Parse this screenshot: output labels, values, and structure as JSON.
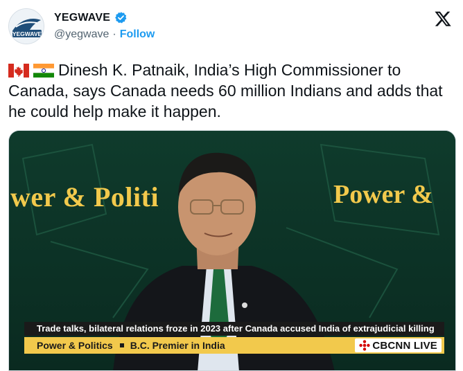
{
  "header": {
    "display_name": "YEGWAVE",
    "handle": "@yegwave",
    "separator": "·",
    "follow_label": "Follow",
    "avatar_text": "YEGWAVE"
  },
  "tweet": {
    "text": "Dinesh K. Patnaik, India’s High Commissioner to Canada, says Canada needs 60 million Indians and adds that he could help make it happen."
  },
  "video": {
    "show_left": "wer & Politi",
    "show_right": "Power &",
    "ticker": "Trade talks, bilateral relations froze in 2023 after Canada accused India of extrajudicial killing",
    "lower_a": "Power & Politics",
    "lower_b": "B.C. Premier in India",
    "live_badge": "CBCNN LIVE"
  },
  "colors": {
    "accent": "#1d9bf0",
    "verified": "#1d9bf0",
    "banner_yellow": "#f2c94c"
  },
  "icons": [
    "x-logo-icon",
    "verified-badge-icon",
    "canada-flag-icon",
    "india-flag-icon",
    "cbc-gem-icon"
  ]
}
